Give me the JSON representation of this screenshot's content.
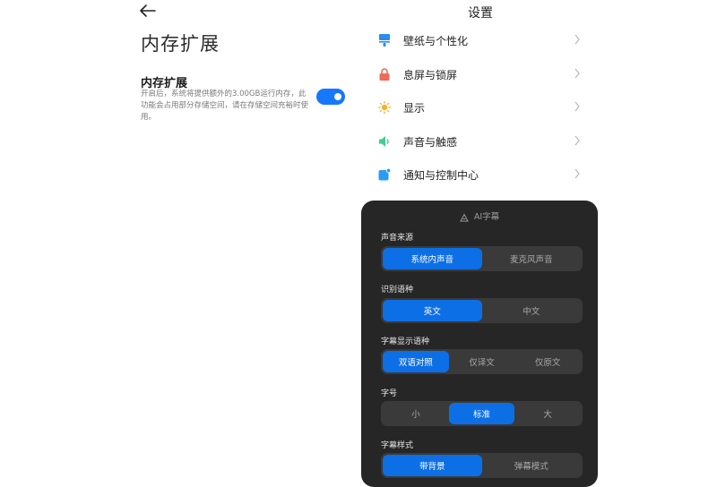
{
  "memory": {
    "page_title": "内存扩展",
    "setting_title": "内存扩展",
    "description": "开启后，系统将提供额外的3.00GB运行内存，此功能会占用部分存储空间，请在存储空间充裕时使用。",
    "enabled": true
  },
  "settings": {
    "title": "设置",
    "items": [
      {
        "label": "壁纸与个性化",
        "icon": "wallpaper-icon",
        "color": "#2b8cf0"
      },
      {
        "label": "息屏与锁屏",
        "icon": "lock-icon",
        "color": "#f06a5a"
      },
      {
        "label": "显示",
        "icon": "sun-icon",
        "color": "#f5b323"
      },
      {
        "label": "声音与触感",
        "icon": "speaker-icon",
        "color": "#3ccf8e"
      },
      {
        "label": "通知与控制中心",
        "icon": "notification-icon",
        "color": "#2b9cf5"
      }
    ]
  },
  "ai_subtitle": {
    "title": "AI字幕",
    "sections": [
      {
        "label": "声音来源",
        "options": [
          "系统内声音",
          "麦克风声音"
        ],
        "selected": 0
      },
      {
        "label": "识别语种",
        "options": [
          "英文",
          "中文"
        ],
        "selected": 0
      },
      {
        "label": "字幕显示语种",
        "options": [
          "双语对照",
          "仅译文",
          "仅原文"
        ],
        "selected": 0
      },
      {
        "label": "字号",
        "options": [
          "小",
          "标准",
          "大"
        ],
        "selected": 1
      },
      {
        "label": "字幕样式",
        "options": [
          "带背景",
          "弹幕模式"
        ],
        "selected": 0
      }
    ]
  },
  "colors": {
    "accent": "#1677ff",
    "panel_bg": "#262626",
    "segment_active": "#0d6fe6"
  }
}
